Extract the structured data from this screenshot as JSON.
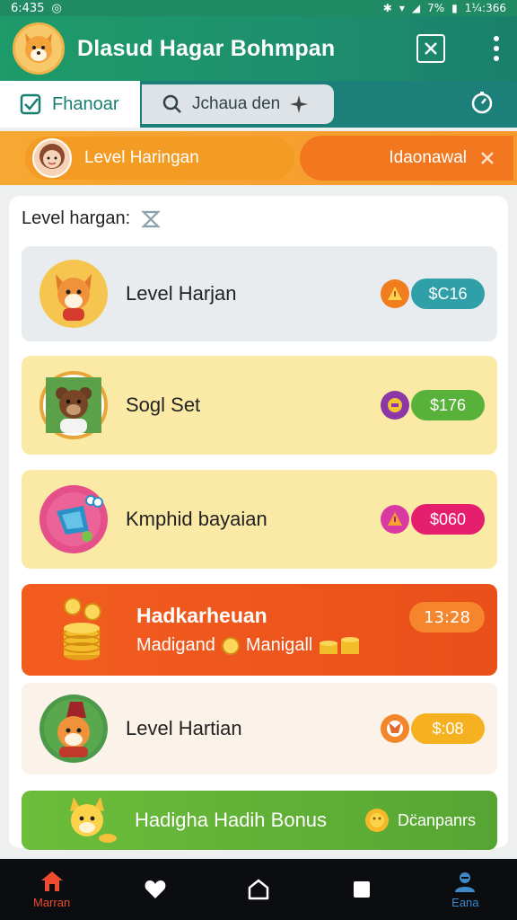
{
  "status_bar": {
    "time": "6:435",
    "battery": "7%",
    "clock": "1¼:366"
  },
  "app_bar": {
    "title": "Dlasud Hagar Bohmpan"
  },
  "tabs": {
    "active_label": "Fhanoar",
    "search_label": "Jchaua den"
  },
  "banner": {
    "label": "Level Haringan",
    "button_label": "Idaonawal"
  },
  "panel": {
    "heading": "Level hargan:"
  },
  "cards": [
    {
      "title": "Level Harjan",
      "price": "$C16",
      "badge_color": "#f07d1e",
      "price_color": "#2f9fa8"
    },
    {
      "title": "Sogl Set",
      "price": "$176",
      "badge_color": "#8b37a6",
      "price_color": "#58b23a"
    },
    {
      "title": "Kmphid bayaian",
      "price": "$060",
      "badge_color": "#d83aa1",
      "price_color": "#e51f6e"
    },
    {
      "title": "Level Hartian",
      "price": "$:08",
      "badge_color": "#f2862a",
      "price_color": "#f5b11f"
    }
  ],
  "promo": {
    "line1": "Hadkarheuan",
    "line2a": "Madigand",
    "line2b": "Manigall",
    "time": "13:28"
  },
  "bonus": {
    "title": "Hadigha Hadih Bonus",
    "label": "Dc̈anpanrs"
  },
  "bottom_nav": [
    {
      "label": "Marran",
      "icon": "home-icon",
      "color": "#ef4b2e"
    },
    {
      "label": "",
      "icon": "heart-icon",
      "color": "#ffffff"
    },
    {
      "label": "",
      "icon": "house-outline-icon",
      "color": "#ffffff"
    },
    {
      "label": "",
      "icon": "square-icon",
      "color": "#ffffff"
    },
    {
      "label": "Eana",
      "icon": "profile-icon",
      "color": "#3d89c9"
    }
  ]
}
